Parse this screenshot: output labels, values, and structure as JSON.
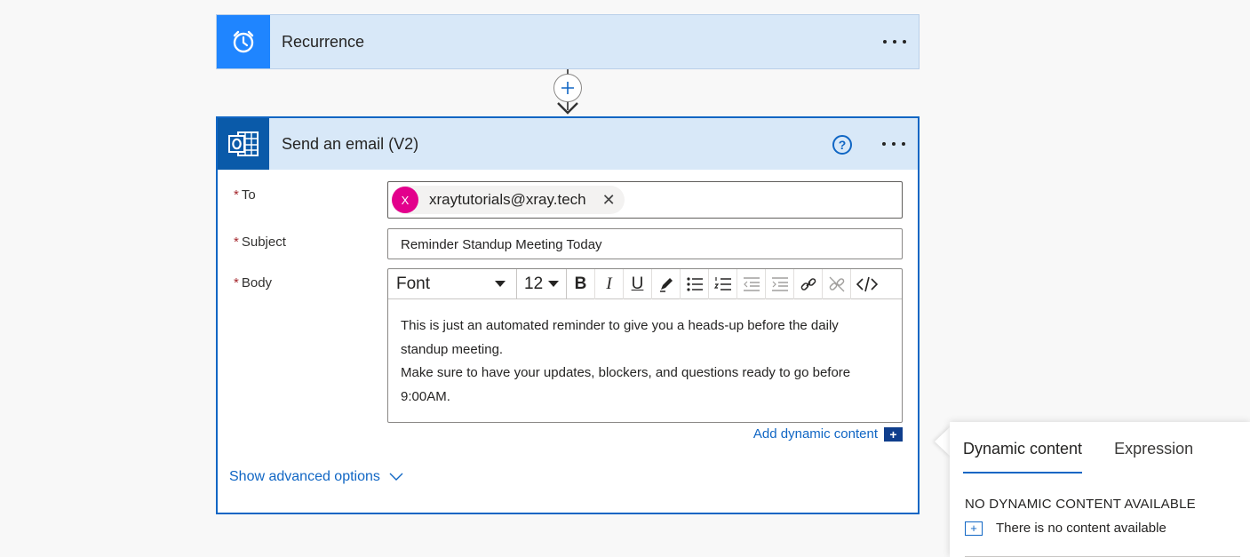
{
  "recurrence": {
    "title": "Recurrence",
    "icon": "alarm-clock-icon"
  },
  "connector": {
    "icon": "plus-icon"
  },
  "email_action": {
    "title": "Send an email (V2)",
    "icon": "outlook-icon",
    "to": {
      "label": "To",
      "required_mark": "*",
      "token_initial": "X",
      "token_email": "xraytutorials@xray.tech",
      "token_color": "#e3008c"
    },
    "subject": {
      "label": "Subject",
      "required_mark": "*",
      "value": "Reminder Standup Meeting Today"
    },
    "body": {
      "label": "Body",
      "required_mark": "*",
      "toolbar": {
        "font": "Font",
        "size": "12",
        "bold": "B",
        "italic": "I",
        "underline": "U"
      },
      "lines": [
        "This is just an automated reminder to give you a heads-up before the daily",
        "standup meeting.",
        "Make sure to have your updates, blockers, and questions ready to go before",
        "9:00AM."
      ]
    },
    "add_dynamic_content": "Add dynamic content",
    "show_advanced": "Show advanced options"
  },
  "dynamic_panel": {
    "tabs": [
      "Dynamic content",
      "Expression"
    ],
    "active_tab": "Dynamic content",
    "empty_heading": "NO DYNAMIC CONTENT AVAILABLE",
    "empty_item": "There is no content available"
  },
  "colors": {
    "accent": "#1066c4",
    "header_bg": "#d8e8f8",
    "recurrence_icon_bg": "#1f85ff",
    "outlook_icon_bg": "#0a5aa9"
  }
}
